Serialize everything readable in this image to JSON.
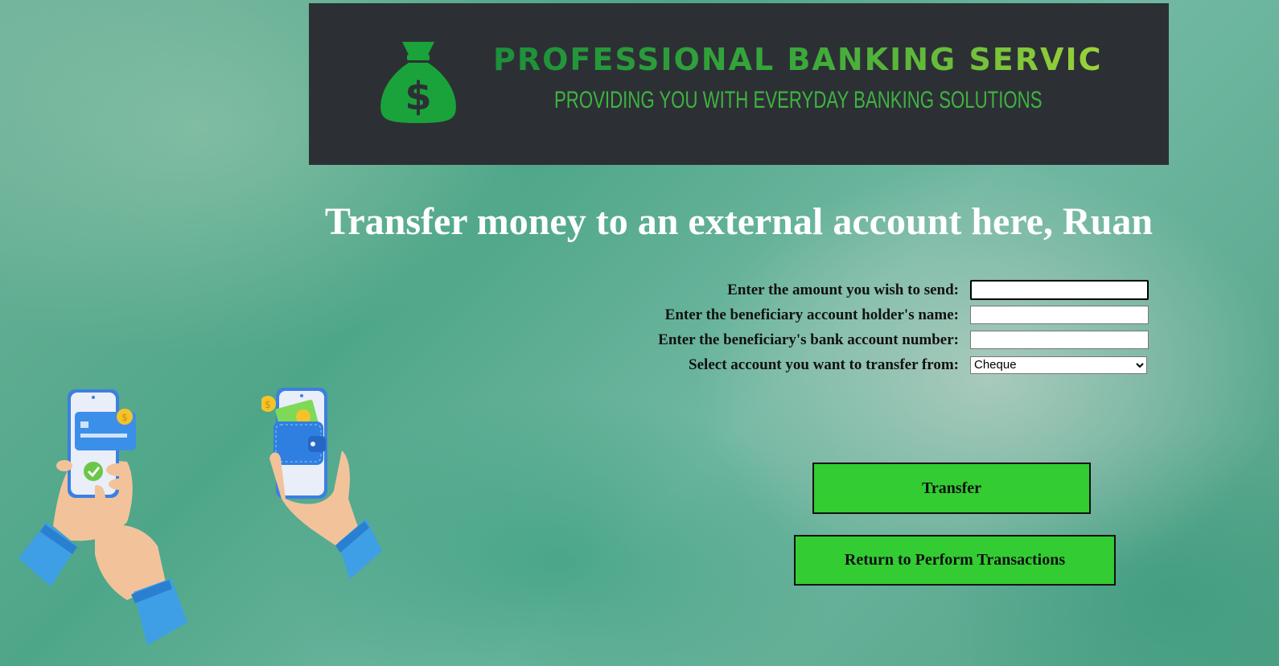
{
  "header": {
    "brand_title": "PROFESSIONAL BANKING SERVICES",
    "brand_subtitle": "PROVIDING YOU WITH EVERYDAY BANKING SOLUTIONS",
    "logo_icon": "money-bag-icon",
    "logo_symbol": "$"
  },
  "main": {
    "heading": "Transfer money to an external account here, Ruan"
  },
  "form": {
    "amount_label": "Enter the amount you wish to send:",
    "amount_value": "",
    "holder_label": "Enter the beneficiary account holder's name:",
    "holder_value": "",
    "account_number_label": "Enter the beneficiary's bank account number:",
    "account_number_value": "",
    "from_account_label": "Select account you want to transfer from:",
    "from_account_selected": "Cheque"
  },
  "actions": {
    "transfer_label": "Transfer",
    "return_label": "Return to Perform Transactions"
  },
  "colors": {
    "banner_bg": "#2c3035",
    "brand_green": "#3aa83a",
    "button_green": "#33cc33"
  }
}
